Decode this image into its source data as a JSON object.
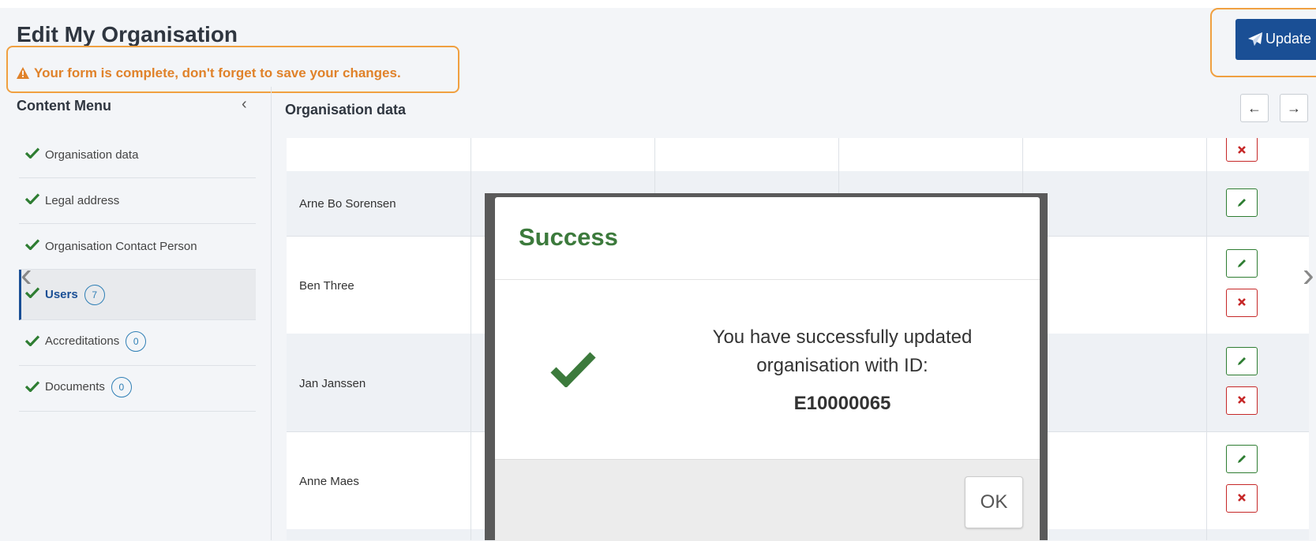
{
  "page": {
    "title": "Edit My Organisation",
    "alert": "Your form is complete, don't forget to save your changes.",
    "update_label": "Update"
  },
  "content_menu": {
    "title": "Content Menu",
    "collapse_glyph": "‹",
    "items": [
      {
        "label": "Organisation data"
      },
      {
        "label": "Legal address"
      },
      {
        "label": "Organisation Contact Person"
      },
      {
        "label": "Users",
        "count": "7"
      },
      {
        "label": "Accreditations",
        "count": "0"
      },
      {
        "label": "Documents",
        "count": "0"
      }
    ]
  },
  "section": {
    "title": "Organisation data",
    "prev_glyph": "←",
    "next_glyph": "→"
  },
  "users": [
    {
      "name": "Arne Bo Sorensen"
    },
    {
      "name": "Ben Three"
    },
    {
      "name": "Jan Janssen"
    },
    {
      "name": "Anne Maes"
    }
  ],
  "carousel": {
    "prev": "‹",
    "next": "›"
  },
  "modal": {
    "title": "Success",
    "message": "You have successfully updated organisation with ID:",
    "id": "E10000065",
    "ok_label": "OK"
  },
  "colors": {
    "primary": "#1a4f95",
    "success": "#3c7a3c",
    "warning": "#e0822a",
    "danger": "#c62828"
  }
}
